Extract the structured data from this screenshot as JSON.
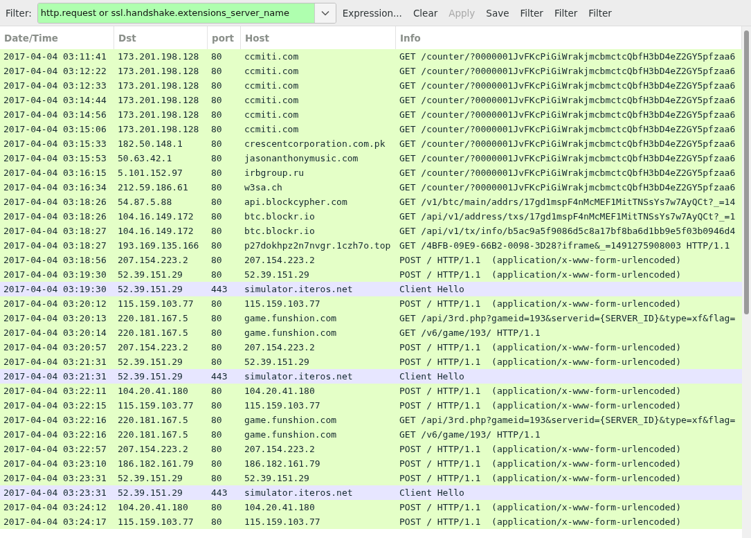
{
  "filter_bar": {
    "label": "Filter:",
    "value": "http.request or ssl.handshake.extensions_server_name",
    "valid": true,
    "buttons": [
      {
        "label": "Expression...",
        "disabled": false
      },
      {
        "label": "Clear",
        "disabled": false
      },
      {
        "label": "Apply",
        "disabled": true
      },
      {
        "label": "Save",
        "disabled": false
      },
      {
        "label": "Filter",
        "disabled": false
      },
      {
        "label": "Filter",
        "disabled": false
      },
      {
        "label": "Filter",
        "disabled": false
      }
    ]
  },
  "table": {
    "columns": [
      "Date/Time",
      "Dst",
      "port",
      "Host",
      "Info"
    ],
    "rows": [
      {
        "color": "#e4ffc7",
        "cells": [
          "2017-04-04 03:11:41",
          "173.201.198.128",
          "80",
          "ccmiti.com",
          "GET /counter/?0000001JvFKcPiGiWrakjmcbmctcQbfH3bD4eZ2GY5pfzaa6"
        ]
      },
      {
        "color": "#e4ffc7",
        "cells": [
          "2017-04-04 03:12:22",
          "173.201.198.128",
          "80",
          "ccmiti.com",
          "GET /counter/?0000001JvFKcPiGiWrakjmcbmctcQbfH3bD4eZ2GY5pfzaa6"
        ]
      },
      {
        "color": "#e4ffc7",
        "cells": [
          "2017-04-04 03:12:33",
          "173.201.198.128",
          "80",
          "ccmiti.com",
          "GET /counter/?0000001JvFKcPiGiWrakjmcbmctcQbfH3bD4eZ2GY5pfzaa6"
        ]
      },
      {
        "color": "#e4ffc7",
        "cells": [
          "2017-04-04 03:14:44",
          "173.201.198.128",
          "80",
          "ccmiti.com",
          "GET /counter/?0000001JvFKcPiGiWrakjmcbmctcQbfH3bD4eZ2GY5pfzaa6"
        ]
      },
      {
        "color": "#e4ffc7",
        "cells": [
          "2017-04-04 03:14:56",
          "173.201.198.128",
          "80",
          "ccmiti.com",
          "GET /counter/?0000001JvFKcPiGiWrakjmcbmctcQbfH3bD4eZ2GY5pfzaa6"
        ]
      },
      {
        "color": "#e4ffc7",
        "cells": [
          "2017-04-04 03:15:06",
          "173.201.198.128",
          "80",
          "ccmiti.com",
          "GET /counter/?0000001JvFKcPiGiWrakjmcbmctcQbfH3bD4eZ2GY5pfzaa6"
        ]
      },
      {
        "color": "#e4ffc7",
        "cells": [
          "2017-04-04 03:15:33",
          "182.50.148.1",
          "80",
          "crescentcorporation.com.pk",
          "GET /counter/?0000001JvFKcPiGiWrakjmcbmctcQbfH3bD4eZ2GY5pfzaa6"
        ]
      },
      {
        "color": "#e4ffc7",
        "cells": [
          "2017-04-04 03:15:53",
          "50.63.42.1",
          "80",
          "jasonanthonymusic.com",
          "GET /counter/?0000001JvFKcPiGiWrakjmcbmctcQbfH3bD4eZ2GY5pfzaa6"
        ]
      },
      {
        "color": "#e4ffc7",
        "cells": [
          "2017-04-04 03:16:15",
          "5.101.152.97",
          "80",
          "irbgroup.ru",
          "GET /counter/?0000001JvFKcPiGiWrakjmcbmctcQbfH3bD4eZ2GY5pfzaa6"
        ]
      },
      {
        "color": "#e4ffc7",
        "cells": [
          "2017-04-04 03:16:34",
          "212.59.186.61",
          "80",
          "w3sa.ch",
          "GET /counter/?0000001JvFKcPiGiWrakjmcbmctcQbfH3bD4eZ2GY5pfzaa6"
        ]
      },
      {
        "color": "#e4ffc7",
        "cells": [
          "2017-04-04 03:18:26",
          "54.87.5.88",
          "80",
          "api.blockcypher.com",
          "GET /v1/btc/main/addrs/17gd1mspF4nMcMEF1MitTNSsYs7w7AyQCt?_=14"
        ]
      },
      {
        "color": "#e4ffc7",
        "cells": [
          "2017-04-04 03:18:26",
          "104.16.149.172",
          "80",
          "btc.blockr.io",
          "GET /api/v1/address/txs/17gd1mspF4nMcMEF1MitTNSsYs7w7AyQCt?_=1"
        ]
      },
      {
        "color": "#e4ffc7",
        "cells": [
          "2017-04-04 03:18:27",
          "104.16.149.172",
          "80",
          "btc.blockr.io",
          "GET /api/v1/tx/info/b5ac9a5f9086d5c8a17bf8ba6d1bb9e5f03b0946d4"
        ]
      },
      {
        "color": "#e4ffc7",
        "cells": [
          "2017-04-04 03:18:27",
          "193.169.135.166",
          "80",
          "p27dokhpz2n7nvgr.1czh7o.top",
          "GET /4BFB-09E9-66B2-0098-3D28?iframe&_=1491275908003 HTTP/1.1"
        ]
      },
      {
        "color": "#e4ffc7",
        "cells": [
          "2017-04-04 03:18:56",
          "207.154.223.2",
          "80",
          "207.154.223.2",
          "POST / HTTP/1.1  (application/x-www-form-urlencoded)"
        ]
      },
      {
        "color": "#e4ffc7",
        "cells": [
          "2017-04-04 03:19:30",
          "52.39.151.29",
          "80",
          "52.39.151.29",
          "POST / HTTP/1.1  (application/x-www-form-urlencoded)"
        ]
      },
      {
        "color": "#e7e6ff",
        "cells": [
          "2017-04-04 03:19:30",
          "52.39.151.29",
          "443",
          "simulator.iteros.net",
          "Client Hello"
        ]
      },
      {
        "color": "#e4ffc7",
        "cells": [
          "2017-04-04 03:20:12",
          "115.159.103.77",
          "80",
          "115.159.103.77",
          "POST / HTTP/1.1  (application/x-www-form-urlencoded)"
        ]
      },
      {
        "color": "#e4ffc7",
        "cells": [
          "2017-04-04 03:20:13",
          "220.181.167.5",
          "80",
          "game.funshion.com",
          "GET /api/3rd.php?gameid=193&serverid={SERVER_ID}&type=xf&flag="
        ]
      },
      {
        "color": "#e4ffc7",
        "cells": [
          "2017-04-04 03:20:14",
          "220.181.167.5",
          "80",
          "game.funshion.com",
          "GET /v6/game/193/ HTTP/1.1"
        ]
      },
      {
        "color": "#e4ffc7",
        "cells": [
          "2017-04-04 03:20:57",
          "207.154.223.2",
          "80",
          "207.154.223.2",
          "POST / HTTP/1.1  (application/x-www-form-urlencoded)"
        ]
      },
      {
        "color": "#e4ffc7",
        "cells": [
          "2017-04-04 03:21:31",
          "52.39.151.29",
          "80",
          "52.39.151.29",
          "POST / HTTP/1.1  (application/x-www-form-urlencoded)"
        ]
      },
      {
        "color": "#e7e6ff",
        "cells": [
          "2017-04-04 03:21:31",
          "52.39.151.29",
          "443",
          "simulator.iteros.net",
          "Client Hello"
        ]
      },
      {
        "color": "#e4ffc7",
        "cells": [
          "2017-04-04 03:22:11",
          "104.20.41.180",
          "80",
          "104.20.41.180",
          "POST / HTTP/1.1  (application/x-www-form-urlencoded)"
        ]
      },
      {
        "color": "#e4ffc7",
        "cells": [
          "2017-04-04 03:22:15",
          "115.159.103.77",
          "80",
          "115.159.103.77",
          "POST / HTTP/1.1  (application/x-www-form-urlencoded)"
        ]
      },
      {
        "color": "#e4ffc7",
        "cells": [
          "2017-04-04 03:22:16",
          "220.181.167.5",
          "80",
          "game.funshion.com",
          "GET /api/3rd.php?gameid=193&serverid={SERVER_ID}&type=xf&flag="
        ]
      },
      {
        "color": "#e4ffc7",
        "cells": [
          "2017-04-04 03:22:16",
          "220.181.167.5",
          "80",
          "game.funshion.com",
          "GET /v6/game/193/ HTTP/1.1"
        ]
      },
      {
        "color": "#e4ffc7",
        "cells": [
          "2017-04-04 03:22:57",
          "207.154.223.2",
          "80",
          "207.154.223.2",
          "POST / HTTP/1.1  (application/x-www-form-urlencoded)"
        ]
      },
      {
        "color": "#e4ffc7",
        "cells": [
          "2017-04-04 03:23:10",
          "186.182.161.79",
          "80",
          "186.182.161.79",
          "POST / HTTP/1.1  (application/x-www-form-urlencoded)"
        ]
      },
      {
        "color": "#e4ffc7",
        "cells": [
          "2017-04-04 03:23:31",
          "52.39.151.29",
          "80",
          "52.39.151.29",
          "POST / HTTP/1.1  (application/x-www-form-urlencoded)"
        ]
      },
      {
        "color": "#e7e6ff",
        "cells": [
          "2017-04-04 03:23:31",
          "52.39.151.29",
          "443",
          "simulator.iteros.net",
          "Client Hello"
        ]
      },
      {
        "color": "#e4ffc7",
        "cells": [
          "2017-04-04 03:24:12",
          "104.20.41.180",
          "80",
          "104.20.41.180",
          "POST / HTTP/1.1  (application/x-www-form-urlencoded)"
        ]
      },
      {
        "color": "#e4ffc7",
        "cells": [
          "2017-04-04 03:24:17",
          "115.159.103.77",
          "80",
          "115.159.103.77",
          "POST / HTTP/1.1  (application/x-www-form-urlencoded)"
        ]
      }
    ]
  }
}
